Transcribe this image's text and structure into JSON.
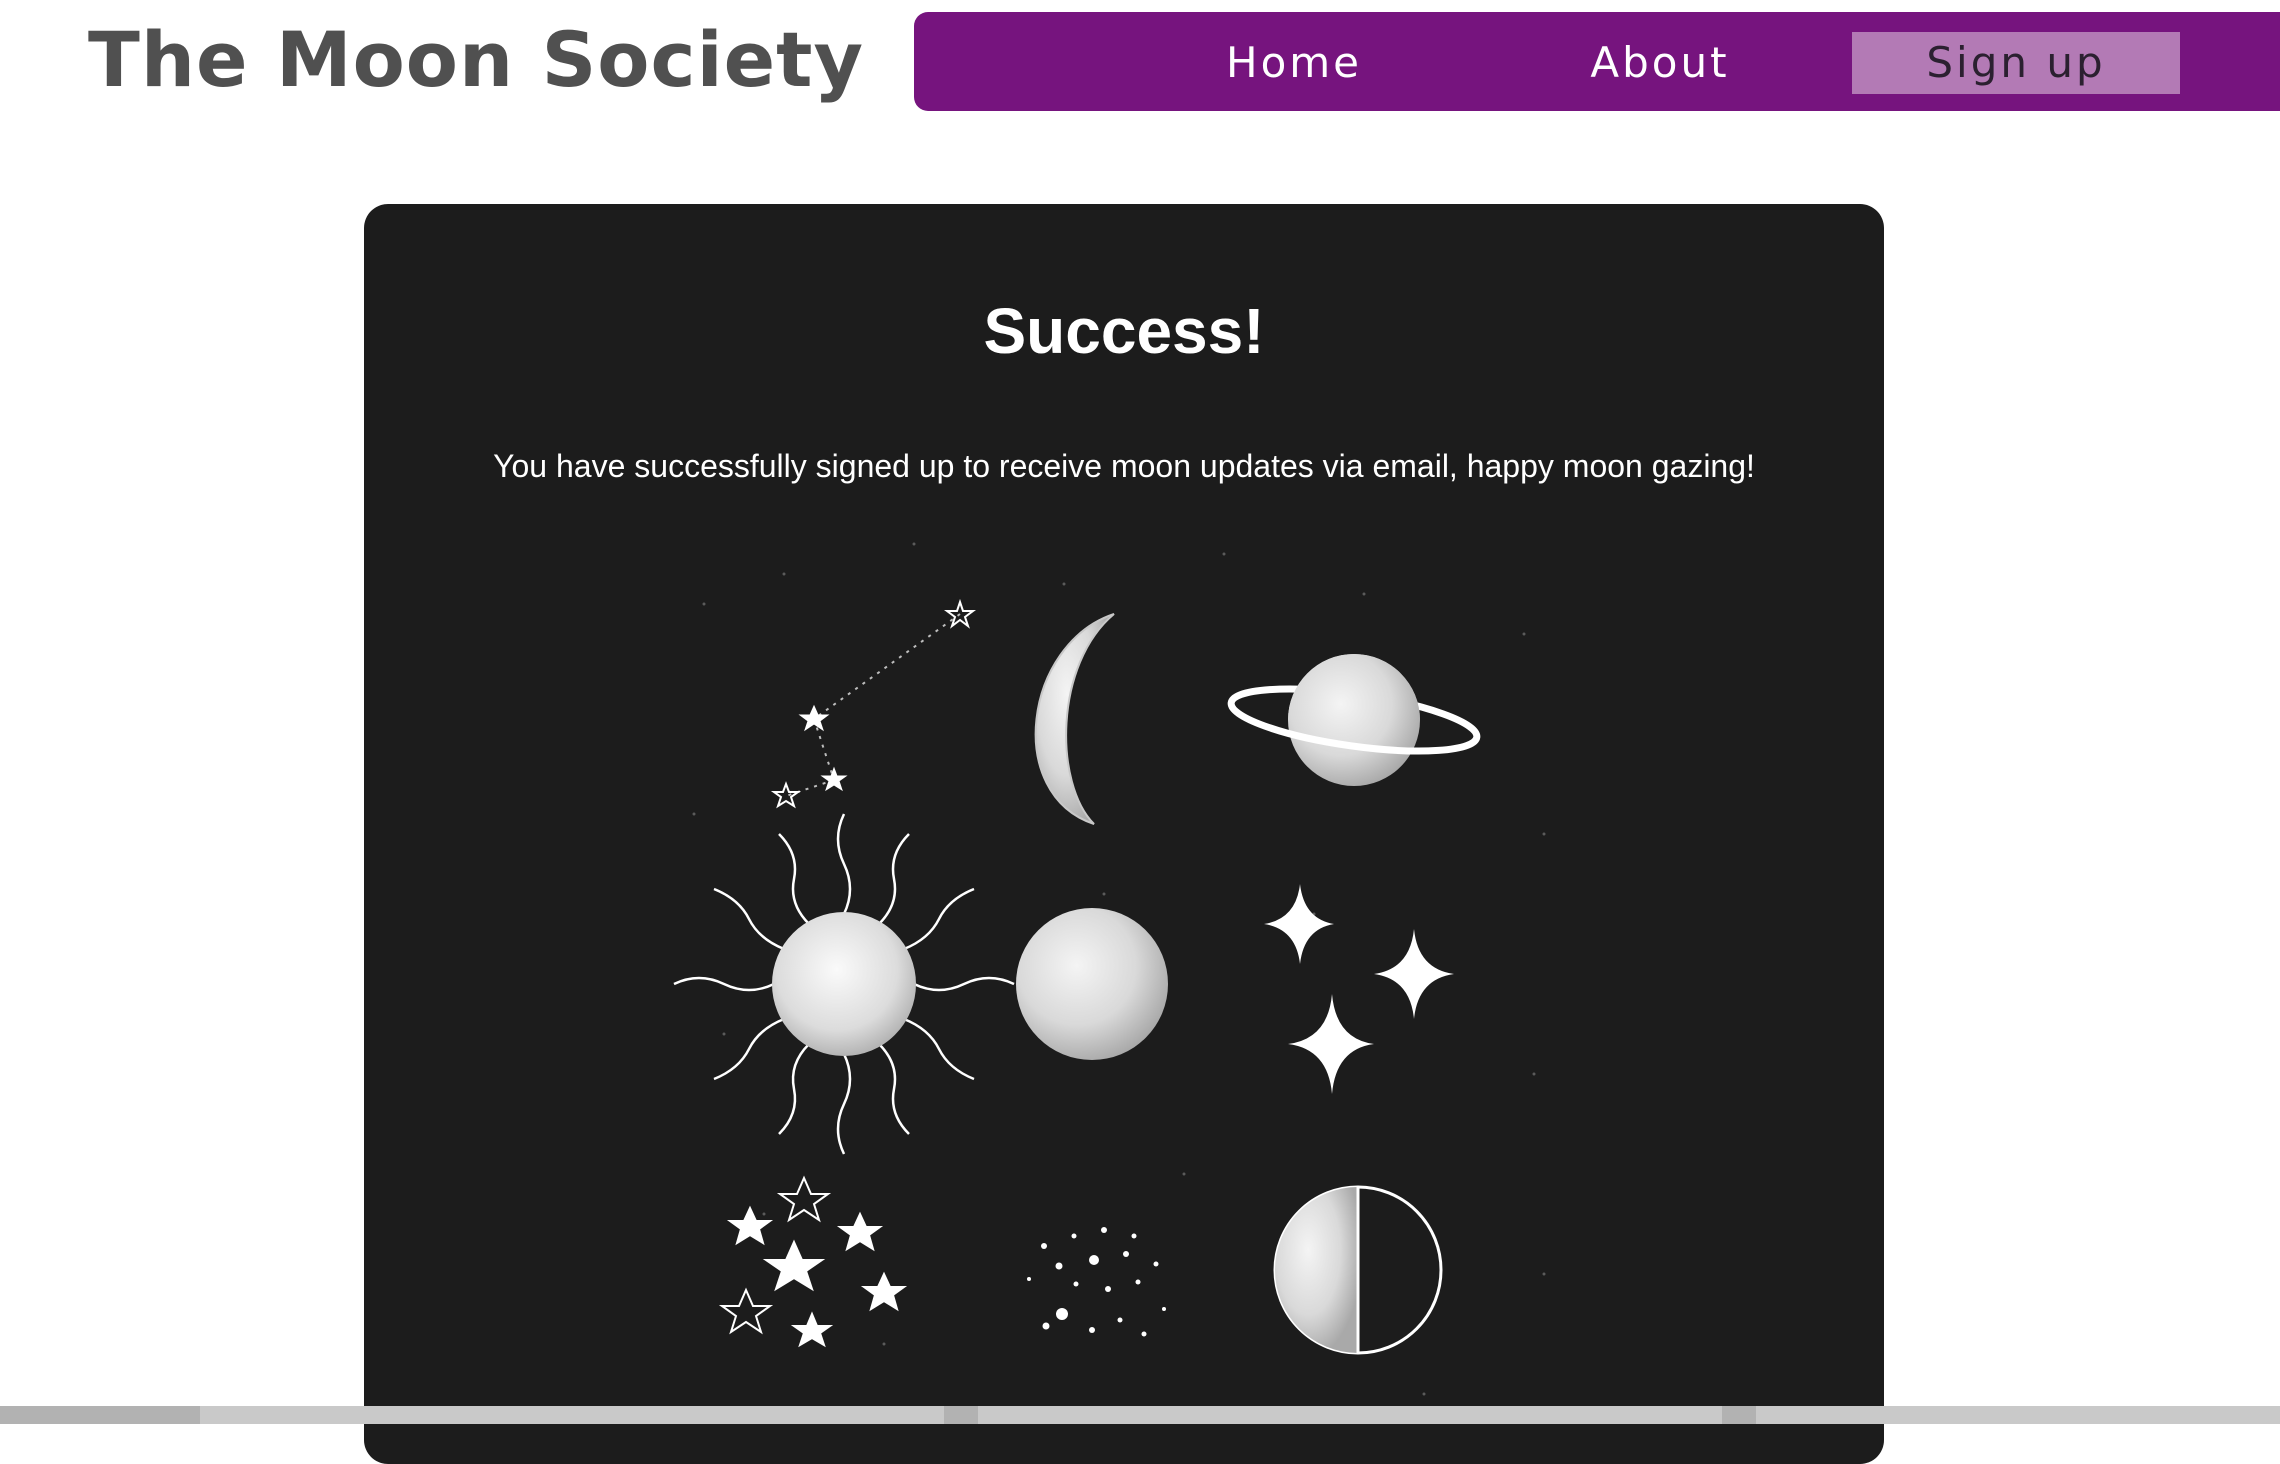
{
  "header": {
    "site_title": "The Moon Society"
  },
  "nav": {
    "home_label": "Home",
    "about_label": "About",
    "signup_label": "Sign up",
    "active_item": "Sign up"
  },
  "card": {
    "title": "Success!",
    "message": "You have successfully signed up to receive moon updates via email, happy moon gazing!"
  },
  "colors": {
    "nav_background": "#76147e",
    "nav_active_background": "#b37ab5",
    "card_background": "#1c1c1c",
    "title_text": "#505050"
  },
  "illustration_icons": [
    "constellation-icon",
    "crescent-moon-icon",
    "ringed-planet-icon",
    "sun-icon",
    "full-moon-icon",
    "sparkles-icon",
    "stars-cluster-icon",
    "stardust-icon",
    "half-moon-icon"
  ]
}
